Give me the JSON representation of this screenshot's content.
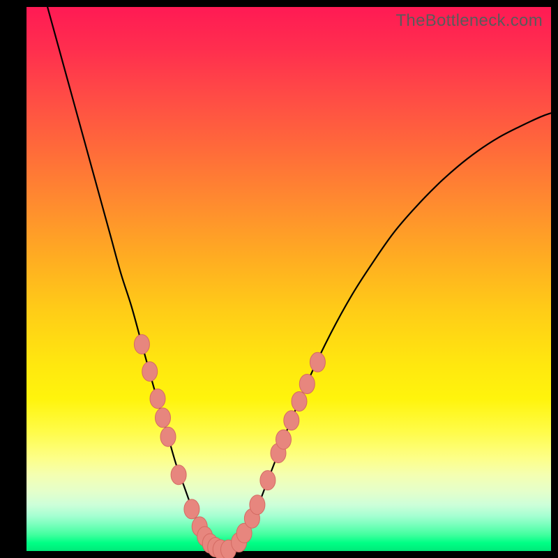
{
  "watermark": "TheBottleneck.com",
  "chart_data": {
    "type": "line",
    "title": "",
    "xlabel": "",
    "ylabel": "",
    "xlim": [
      0,
      100
    ],
    "ylim": [
      0,
      100
    ],
    "series": [
      {
        "name": "curve",
        "x": [
          4,
          6,
          8,
          10,
          12,
          14,
          16,
          18,
          20,
          22,
          24,
          25.5,
          27,
          28.5,
          30,
          31.5,
          33,
          34.5,
          36,
          38,
          40,
          42,
          44,
          46,
          48,
          50,
          54,
          58,
          62,
          66,
          70,
          74,
          78,
          82,
          86,
          90,
          94,
          98,
          100
        ],
        "y": [
          100,
          93,
          86,
          79,
          72,
          65,
          58,
          51,
          45,
          38,
          31,
          26,
          21,
          16,
          12,
          8,
          4.5,
          2,
          0.6,
          0.2,
          1.2,
          4,
          8,
          13,
          18,
          23,
          32,
          40,
          47,
          53,
          58.5,
          63,
          67,
          70.5,
          73.5,
          76,
          78,
          79.8,
          80.5
        ]
      }
    ],
    "markers": [
      {
        "axis_x": 22.0,
        "axis_y": 38.0
      },
      {
        "axis_x": 23.5,
        "axis_y": 33.0
      },
      {
        "axis_x": 25.0,
        "axis_y": 28.0
      },
      {
        "axis_x": 26.0,
        "axis_y": 24.5
      },
      {
        "axis_x": 27.0,
        "axis_y": 21.0
      },
      {
        "axis_x": 29.0,
        "axis_y": 14.0
      },
      {
        "axis_x": 31.5,
        "axis_y": 7.7
      },
      {
        "axis_x": 33.0,
        "axis_y": 4.5
      },
      {
        "axis_x": 34.0,
        "axis_y": 2.7
      },
      {
        "axis_x": 35.0,
        "axis_y": 1.4
      },
      {
        "axis_x": 36.0,
        "axis_y": 0.7
      },
      {
        "axis_x": 37.0,
        "axis_y": 0.3
      },
      {
        "axis_x": 38.5,
        "axis_y": 0.25
      },
      {
        "axis_x": 40.5,
        "axis_y": 1.6
      },
      {
        "axis_x": 41.5,
        "axis_y": 3.3
      },
      {
        "axis_x": 43.0,
        "axis_y": 6.0
      },
      {
        "axis_x": 44.0,
        "axis_y": 8.5
      },
      {
        "axis_x": 46.0,
        "axis_y": 13.0
      },
      {
        "axis_x": 48.0,
        "axis_y": 18.0
      },
      {
        "axis_x": 49.0,
        "axis_y": 20.5
      },
      {
        "axis_x": 50.5,
        "axis_y": 24.0
      },
      {
        "axis_x": 52.0,
        "axis_y": 27.5
      },
      {
        "axis_x": 53.5,
        "axis_y": 30.7
      },
      {
        "axis_x": 55.5,
        "axis_y": 34.7
      }
    ],
    "colors": {
      "curve": "#000000",
      "marker_fill": "#e7867e",
      "marker_stroke": "#d46a62"
    }
  }
}
